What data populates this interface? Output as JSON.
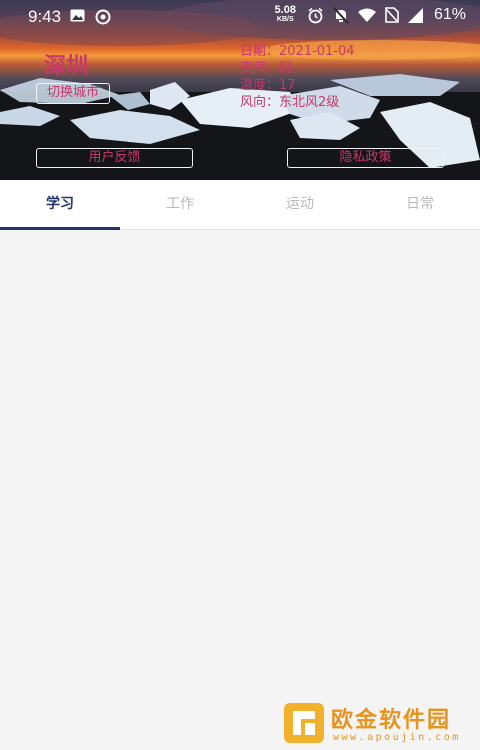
{
  "status_bar": {
    "time": "9:43",
    "net_speed_value": "5.08",
    "net_speed_unit": "KB/S",
    "battery": "61%",
    "left_icons": [
      "image-icon",
      "eye-circle-icon"
    ],
    "right_icons": [
      "alarm-icon",
      "mute-bell-icon",
      "wifi-icon",
      "no-sim-icon",
      "signal-icon"
    ]
  },
  "weather": {
    "city": "深圳",
    "switch_city_label": "切换城市",
    "date": "日期：2021-01-04",
    "weather": "天气：阴",
    "temperature": "温度：17",
    "wind": "风向：东北风2级"
  },
  "buttons": {
    "feedback": "用户反馈",
    "privacy": "隐私政策"
  },
  "tabs": [
    {
      "label": "学习",
      "active": true
    },
    {
      "label": "工作",
      "active": false
    },
    {
      "label": "运动",
      "active": false
    },
    {
      "label": "日常",
      "active": false
    }
  ],
  "watermark": {
    "title": "欧金软件园",
    "url": "www.apoujin.com"
  },
  "colors": {
    "accent": "#21346e",
    "overlay_text": "#c8386a",
    "inactive_tab": "#b9b9b9",
    "watermark": "#e8931c"
  }
}
